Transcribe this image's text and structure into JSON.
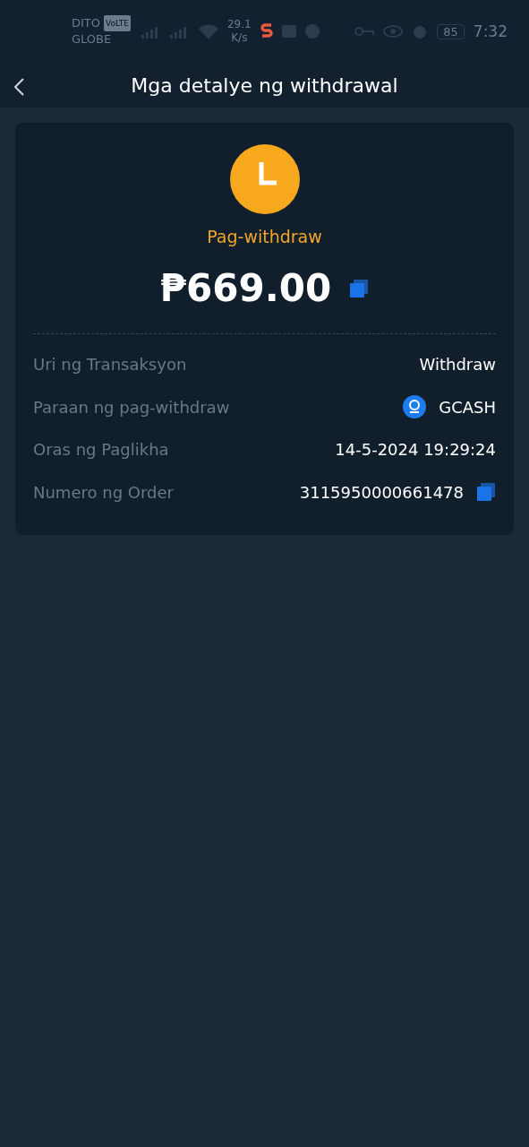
{
  "status_bar": {
    "carrier": "DITO",
    "network_badge": "VoLTE",
    "carrier_2": "GLOBE",
    "speed": "29.1",
    "speed_unit": "K/s",
    "battery": "85",
    "time": "7:32"
  },
  "header": {
    "title": "Mga detalye ng withdrawal"
  },
  "summary": {
    "status": "Pag-withdraw",
    "amount": "₱669.00"
  },
  "details": [
    {
      "kind": "plain",
      "label": "Uri ng Transaksyon",
      "value": "Withdraw"
    },
    {
      "kind": "wallet",
      "label": "Paraan ng pag-withdraw",
      "value": "GCASH"
    },
    {
      "kind": "plain",
      "label": "Oras ng Paglikha",
      "value": "14-5-2024 19:29:24"
    },
    {
      "kind": "copyable",
      "label": "Numero ng Order",
      "value": "3115950000661478"
    }
  ]
}
